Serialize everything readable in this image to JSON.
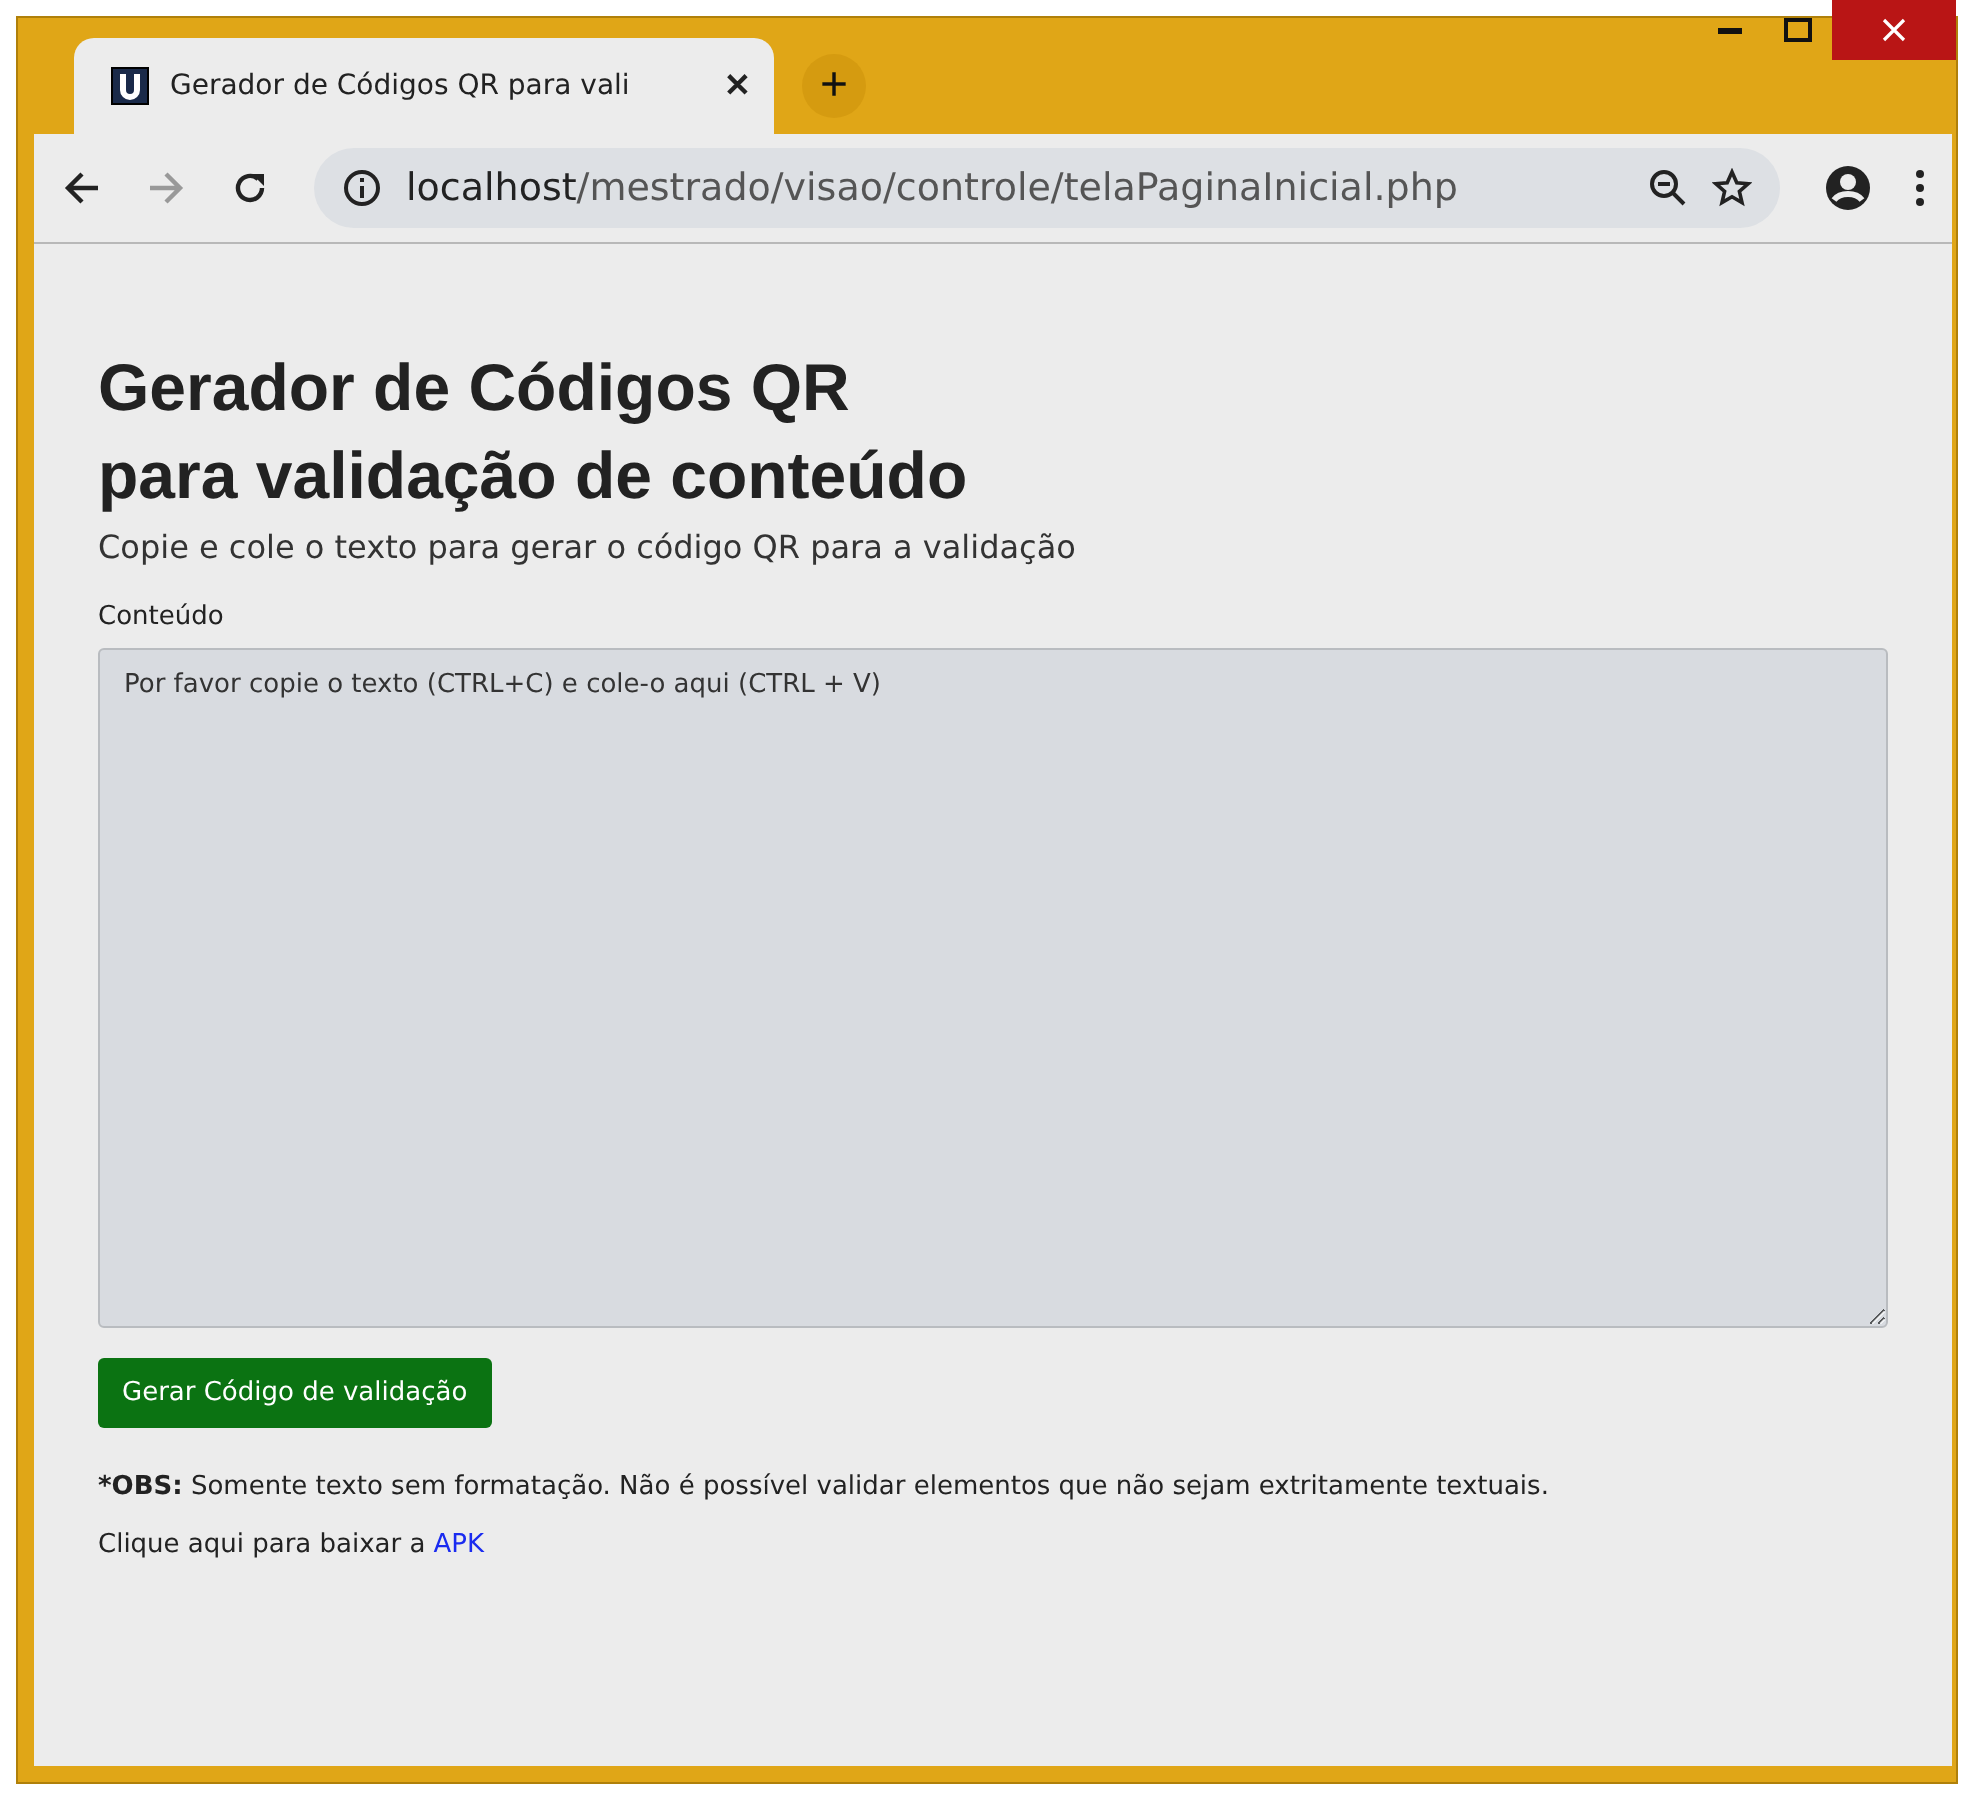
{
  "browser": {
    "tab": {
      "title": "Gerador de Códigos QR para vali",
      "close": "✕"
    },
    "new_tab": "+",
    "address": "**localhost**/mestrado/visao/controle/telaPaginaInicial.php"
  },
  "page": {
    "title_lines": [
      "Gerador de Códigos QR",
      "para validação de conteúdo"
    ],
    "subtitle": "Copie e cole o texto para gerar o código QR para a validação",
    "field": {
      "label": "Conteúdo",
      "placeholder": "Por favor copie o texto (CTRL+C) e cole-o aqui (CTRL + V)"
    },
    "button": "Gerar Código de validação",
    "note": {
      "label": "*OBS:",
      "text": "Somente texto sem formatação. Não é possível validar elementos que não sejam extritamente textuais."
    },
    "download": {
      "text": "Clique aqui para baixar a",
      "link": "APK"
    }
  }
}
